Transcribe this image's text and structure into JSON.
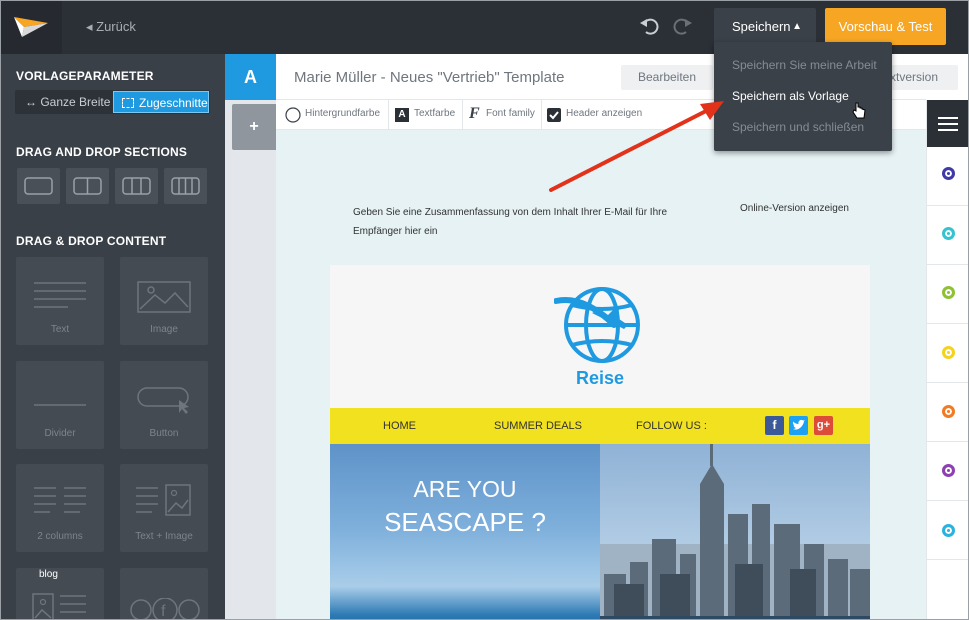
{
  "header": {
    "back_label": "◂ Zurück",
    "save_label": "Speichern",
    "save_caret": "▲",
    "preview_label": "Vorschau & Test"
  },
  "save_menu": {
    "items": [
      {
        "label": "Speichern Sie meine Arbeit"
      },
      {
        "label": "Speichern als Vorlage"
      },
      {
        "label": "Speichern und schließen"
      }
    ]
  },
  "sidebar": {
    "params_heading": "VORLAGEPARAMETER",
    "width_full": "↔  Ganze Breite",
    "width_cut": "Zugeschnitte",
    "sections_heading": "DRAG AND DROP SECTIONS",
    "content_heading": "DRAG & DROP CONTENT",
    "tiles": [
      {
        "label": "Text"
      },
      {
        "label": "Image"
      },
      {
        "label": "Divider"
      },
      {
        "label": "Button"
      },
      {
        "label": "2 columns"
      },
      {
        "label": "Text + Image"
      },
      {
        "label": "blog"
      }
    ]
  },
  "tabs": {
    "a_label": "A",
    "add_label": "+"
  },
  "title_bar": {
    "title": "Marie Müller  -  Neues \"Vertrieb\" Template",
    "edit_label": "Bearbeiten",
    "text_version_label": "xtversion"
  },
  "toolbar": {
    "bg_color": "Hintergrundfarbe",
    "text_color": "Textfarbe",
    "font_family": "Font family",
    "show_header": "Header anzeigen"
  },
  "email": {
    "summary": "Geben Sie eine Zusammenfassung von dem Inhalt Ihrer E-Mail für Ihre Empfänger hier ein",
    "online_version": "Online-Version anzeigen",
    "brand": "Reise",
    "nav": {
      "home": "HOME",
      "deals": "SUMMER DEALS",
      "follow": "FOLLOW US :"
    },
    "hero_line1": "ARE YOU",
    "hero_line2": "SEASCAPE ?"
  },
  "colors": {
    "accent": "#1f9ae0",
    "preview": "#f6a623",
    "nav_bar": "#f2e11e",
    "palette": [
      "#3f3aa8",
      "#35c3d0",
      "#8ec234",
      "#f4d31c",
      "#f27a22",
      "#8e3fb3",
      "#2bb3e0"
    ]
  }
}
